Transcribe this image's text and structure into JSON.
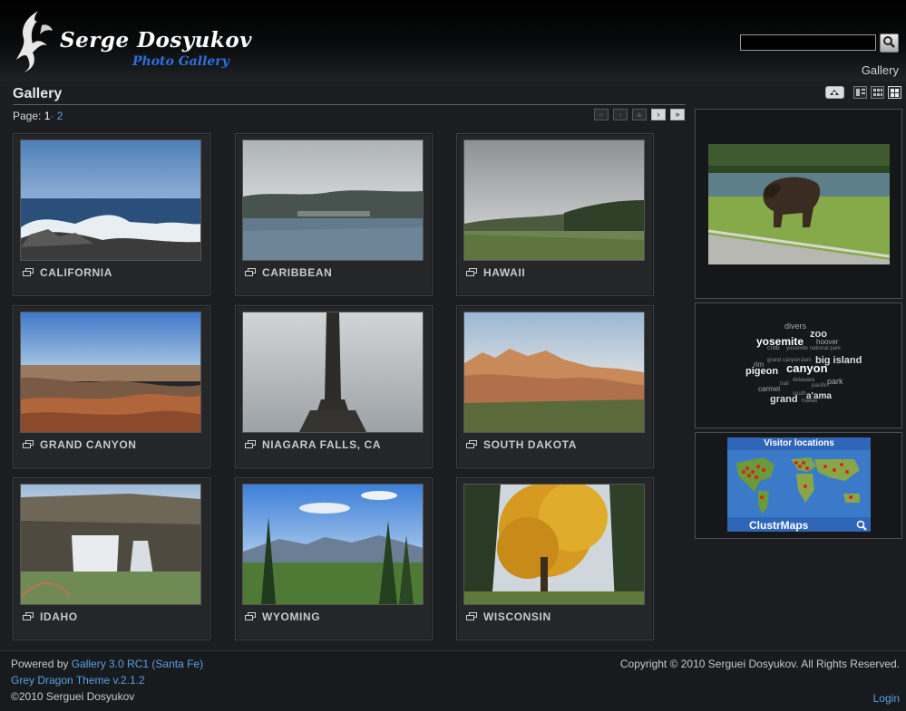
{
  "header": {
    "site_title": "Serge Dosyukov",
    "site_subtitle": "Photo Gallery",
    "search_placeholder": "",
    "breadcrumb": "Gallery"
  },
  "page": {
    "title": "Gallery",
    "pager_label": "Page:",
    "current_page": "1",
    "page_separator": "·",
    "other_page": "2"
  },
  "albums": [
    {
      "label": "CALIFORNIA"
    },
    {
      "label": "CARIBBEAN"
    },
    {
      "label": "HAWAII"
    },
    {
      "label": "GRAND CANYON"
    },
    {
      "label": "NIAGARA FALLS, CA"
    },
    {
      "label": "SOUTH DAKOTA"
    },
    {
      "label": "IDAHO"
    },
    {
      "label": "WYOMING"
    },
    {
      "label": "WISCONSIN"
    }
  ],
  "tag_cloud": {
    "tags": [
      "divers",
      "zoo",
      "yosemite",
      "hoover",
      "crab",
      "yosemite national park",
      "rim",
      "grand canyon",
      "dam",
      "big island",
      "pigeon",
      "canyon",
      "delaware",
      "park",
      "carmel",
      "trail",
      "pacific",
      "grand",
      "a'ama",
      "south",
      "hawaii"
    ]
  },
  "map_widget": {
    "title": "Visitor locations",
    "brand": "ClustrMaps"
  },
  "footer": {
    "powered_prefix": "Powered by ",
    "powered_link": "Gallery 3.0 RC1 (Santa Fe)",
    "theme_link": "Grey Dragon Theme v.2.1.2",
    "copyright_short": "©2010 Serguei Dosyukov",
    "copyright_full": "Copyright © 2010 Serguei Dosyukov. All Rights Reserved.",
    "login_link": "Login"
  },
  "colors": {
    "background": "#1b1e20",
    "link": "#5b9fe8",
    "subtitle_blue": "#2f6fe0"
  }
}
